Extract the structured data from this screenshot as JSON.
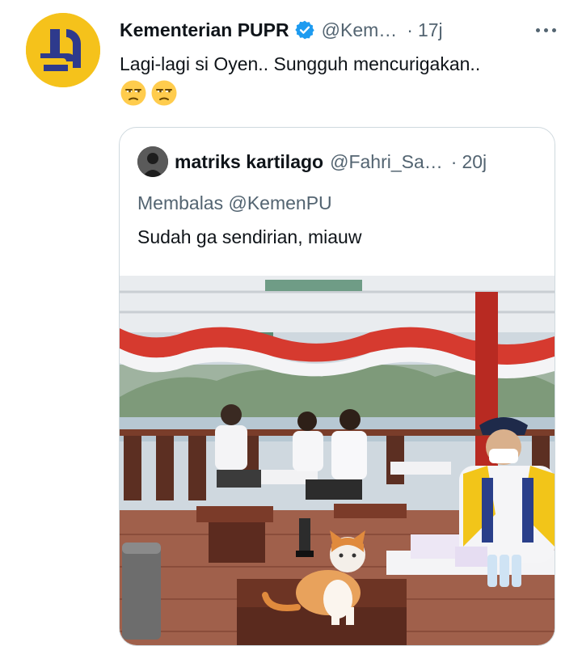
{
  "tweet": {
    "display_name": "Kementerian PUPR",
    "handle": "@Kem…",
    "time": "17j",
    "text": "Lagi-lagi si Oyen.. Sungguh mencurigakan..",
    "emojis": [
      "unamused-face-icon",
      "unamused-face-icon"
    ],
    "more_icon": "more-horizontal-icon",
    "verified_icon": "verified-badge-icon",
    "colors": {
      "avatar_bg": "#f5c21b",
      "avatar_mark": "#2e3a8c",
      "verified": "#1d9bf0",
      "secondary_text": "#536471"
    }
  },
  "quoted": {
    "display_name": "matriks kartilago",
    "handle": "@Fahri_Sa…",
    "time": "20j",
    "replying_to": "Membalas @KemenPU",
    "text": "Sudah ga sendirian, miauw",
    "image_alt_icon": "photo-boat-deck-cat"
  }
}
